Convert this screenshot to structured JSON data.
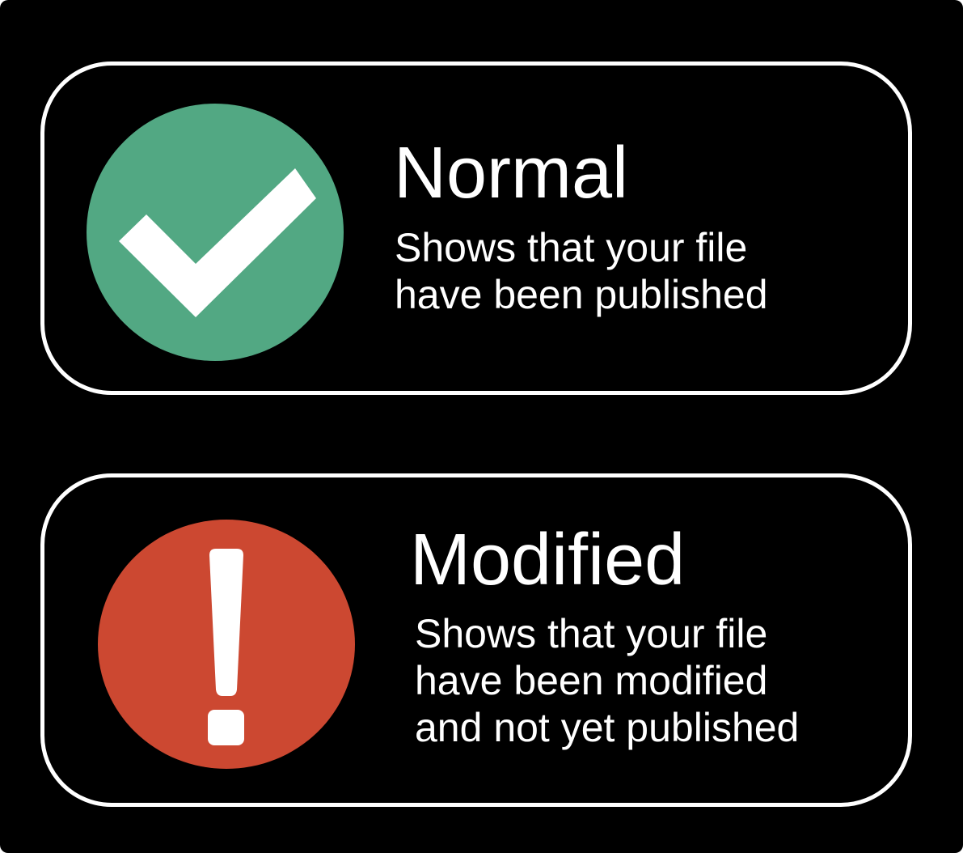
{
  "legend": {
    "items": [
      {
        "status": "normal",
        "icon": "check-icon",
        "color": "#52A883",
        "title": "Normal",
        "description_lines": [
          "Shows that your file",
          "have been published"
        ]
      },
      {
        "status": "modified",
        "icon": "exclamation-icon",
        "color": "#CC4831",
        "title": "Modified",
        "description_lines": [
          "Shows that your file",
          "have been modified",
          "and not yet published"
        ]
      }
    ]
  }
}
